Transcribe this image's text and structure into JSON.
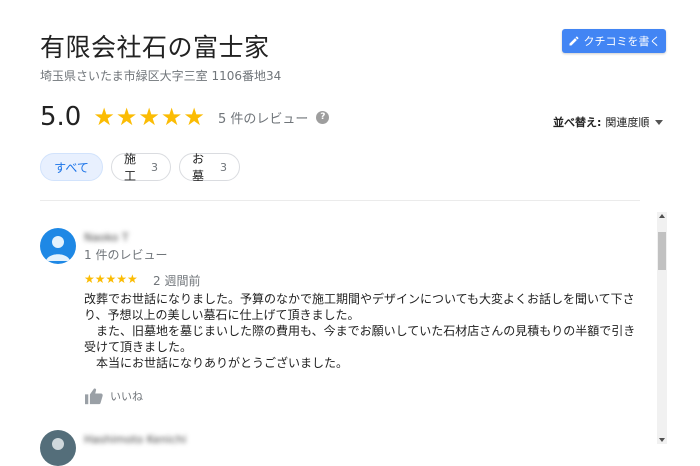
{
  "business": {
    "name": "有限会社石の富士家",
    "address": "埼玉県さいたま市緑区大字三室 1106番地34"
  },
  "write_review_label": "クチコミを書く",
  "rating": {
    "score": "5.0",
    "stars": "★★★★★",
    "review_count": "5 件のレビュー",
    "help_icon": "?"
  },
  "sort": {
    "label": "並べ替え:",
    "value": "関連度順"
  },
  "filters": [
    {
      "label": "すべて",
      "count": ""
    },
    {
      "label": "施工",
      "count": "3"
    },
    {
      "label": "お墓",
      "count": "3"
    }
  ],
  "reviews": [
    {
      "name": "Naoko T",
      "sub": "1 件のレビュー",
      "stars": "★★★★★",
      "date": "2 週間前",
      "text": [
        "改葬でお世話になりました。予算のなかで施工期間やデザインについても大変よくお話しを聞いて下さり、予想以上の美しい墓石に仕上げて頂きました。",
        "　また、旧墓地を墓じまいした際の費用も、今までお願いしていた石材店さんの見積もりの半額で引き受けて頂きました。",
        "　本当にお世話になりありがとうございました。"
      ],
      "like_label": "いいね",
      "avatar_color": "#1e88e5"
    },
    {
      "name": "Hashimoto Kenichi",
      "avatar_color": "#546e7a"
    }
  ],
  "colors": {
    "accent": "#4285f4",
    "star": "#fbbc04",
    "chip_active_bg": "#e8f0fe"
  },
  "icons": {
    "write": "pencil-icon",
    "help": "help-circle-icon",
    "sort": "caret-down-icon",
    "like": "thumbs-up-icon"
  }
}
